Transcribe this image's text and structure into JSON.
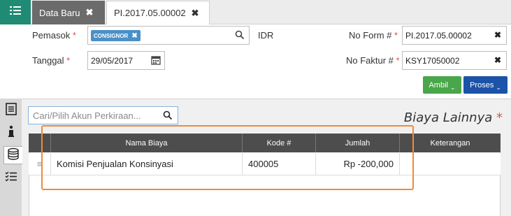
{
  "tabs": [
    {
      "label": "Data Baru"
    },
    {
      "label": "PI.2017.05.00002"
    }
  ],
  "form": {
    "pemasok_label": "Pemasok",
    "pemasok_chip": "CONSIGNOR",
    "currency": "IDR",
    "tanggal_label": "Tanggal",
    "tanggal_value": "29/05/2017",
    "noform_label": "No Form #",
    "noform_value": "PI.2017.05.00002",
    "nofaktur_label": "No Faktur #",
    "nofaktur_value": "KSY17050002",
    "required_mark": "*"
  },
  "actions": {
    "ambil": "Ambil",
    "proses": "Proses"
  },
  "panel": {
    "search_placeholder": "Cari/Pilih Akun Perkiraan...",
    "title": "Biaya Lainnya",
    "title_mark": "*"
  },
  "table": {
    "columns": [
      "Nama Biaya",
      "Kode #",
      "Jumlah",
      "Keterangan"
    ],
    "rows": [
      {
        "nama": "Komisi Penjualan Konsinyasi",
        "kode": "400005",
        "jumlah": "Rp -200,000",
        "keterangan": ""
      }
    ]
  },
  "colors": {
    "brand_green": "#1f8b74",
    "action_green": "#4aa64a",
    "action_blue": "#1c53a8",
    "highlight": "#f08a3a",
    "required": "#d9534f"
  },
  "icons": {
    "menu": "list-menu-icon",
    "search": "search-icon",
    "calendar": "calendar-icon",
    "clear": "close-icon",
    "side": [
      "document-icon",
      "info-icon",
      "money-stack-icon",
      "checklist-icon"
    ]
  }
}
